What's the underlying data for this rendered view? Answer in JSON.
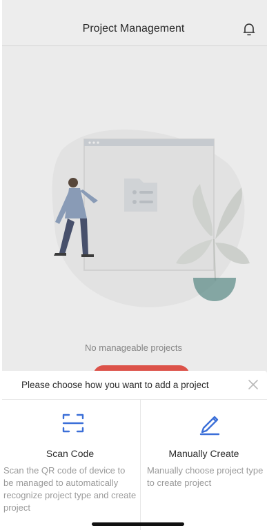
{
  "header": {
    "title": "Project Management",
    "right_icon": "bell-icon"
  },
  "empty_state": {
    "illustration": "person-walking-to-folder-with-plant",
    "message": "No manageable projects"
  },
  "sheet": {
    "title": "Please choose how you want to add a project",
    "close_icon": "close-icon",
    "options": [
      {
        "icon": "scan-icon",
        "title": "Scan Code",
        "description": "Scan the QR code of device to be managed to automatically recognize project type and create project"
      },
      {
        "icon": "pencil-icon",
        "title": "Manually Create",
        "description": "Manually choose project type to create project"
      }
    ]
  },
  "colors": {
    "accent": "#3b6fd8",
    "primary_button": "#e5564d",
    "text_primary": "#2b2b2b",
    "text_secondary": "#9a9a9a"
  }
}
